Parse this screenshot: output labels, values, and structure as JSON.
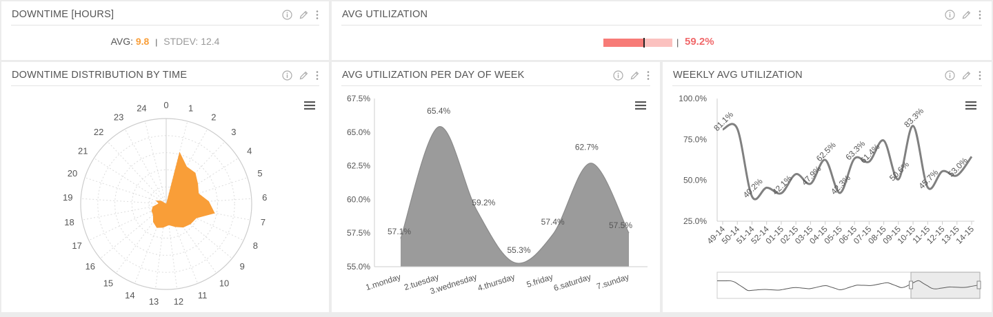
{
  "downtime_hours": {
    "title": "DOWNTIME [HOURS]",
    "avg_label": "AVG:",
    "avg_value": "9.8",
    "separator": "|",
    "stdev_label": "STDEV:",
    "stdev_value": "12.4"
  },
  "avg_utilization": {
    "title": "AVG UTILIZATION",
    "separator": "|",
    "value_text": "59.2%",
    "value": 59.2,
    "colors": {
      "fill": "#f77b77",
      "track": "#fbc1bf",
      "text": "#f0686a"
    }
  },
  "downtime_distribution": {
    "title": "DOWNTIME DISTRIBUTION BY TIME",
    "chart_data": {
      "type": "polar-area",
      "categories": [
        "0",
        "1",
        "2",
        "3",
        "4",
        "5",
        "6",
        "7",
        "8",
        "9",
        "10",
        "11",
        "12",
        "13",
        "14",
        "15",
        "16",
        "17",
        "18",
        "19",
        "20",
        "21",
        "22",
        "23",
        "24"
      ],
      "values": [
        0,
        0.63,
        0.5,
        0.5,
        0.44,
        0.4,
        0.5,
        0.58,
        0.39,
        0.37,
        0.34,
        0.29,
        0.25,
        0.28,
        0.3,
        0.26,
        0.2,
        0.19,
        0.16,
        0.09,
        0.13,
        0.07,
        0.01,
        0.01,
        0
      ],
      "max": 1,
      "color": "#f99e38",
      "grid": true
    }
  },
  "avg_util_dow": {
    "title": "AVG UTILIZATION PER DAY OF WEEK",
    "chart_data": {
      "type": "area",
      "categories": [
        "1.monday",
        "2.tuesday",
        "3.wednesday",
        "4.thursday",
        "5.friday",
        "6.saturday",
        "7.sunday"
      ],
      "values": [
        57.1,
        65.4,
        59.2,
        55.3,
        57.4,
        62.7,
        57.5
      ],
      "labels": [
        "57.1%",
        "65.4%",
        "59.2%",
        "55.3%",
        "57.4%",
        "62.7%",
        "57.5%"
      ],
      "yticks": [
        "67.5%",
        "65.0%",
        "62.5%",
        "60.0%",
        "57.5%",
        "55.0%"
      ],
      "ylim": [
        55,
        67.5
      ],
      "color": "#9b9b9b"
    }
  },
  "weekly_avg": {
    "title": "WEEKLY AVG UTILIZATION",
    "chart_data": {
      "type": "line",
      "categories": [
        "49-14",
        "50-14",
        "51-14",
        "52-14",
        "01-15",
        "02-15",
        "03-15",
        "04-15",
        "05-15",
        "06-15",
        "07-15",
        "08-15",
        "09-15",
        "10-15",
        "11-15",
        "12-15",
        "13-15",
        "14-15"
      ],
      "values": [
        81.1,
        81.5,
        40.2,
        45.5,
        42.1,
        53.8,
        47.9,
        62.5,
        42.3,
        63.3,
        61.4,
        74.3,
        50.6,
        83.3,
        45.7,
        55.5,
        53.0,
        64.5
      ],
      "labels": [
        "81.1%",
        "",
        "40.2%",
        "",
        "42.1%",
        "",
        "47.9%",
        "62.5%",
        "42.3%",
        "63.3%",
        "61.4%",
        "",
        "50.6%",
        "83.3%",
        "45.7%",
        "",
        "53.0%",
        ""
      ],
      "yticks": [
        "100.0%",
        "75.0%",
        "50.0%",
        "25.0%"
      ],
      "ylim": [
        25,
        100
      ],
      "color": "#808080"
    }
  }
}
